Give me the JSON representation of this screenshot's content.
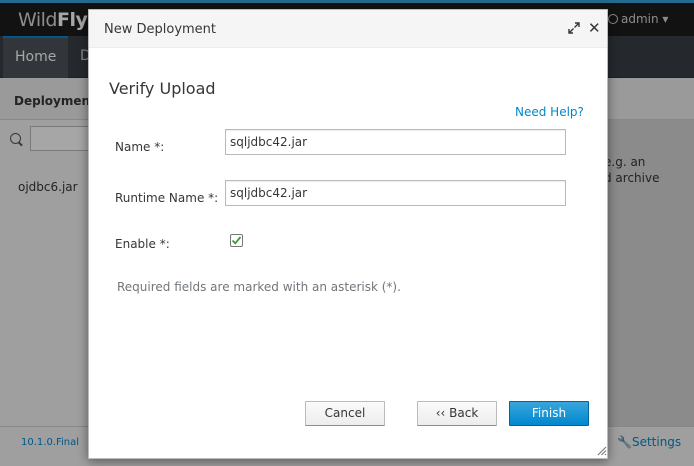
{
  "app": {
    "brand_light": "WildFly",
    "brand_bold": "",
    "user": "admin ▾",
    "nav": {
      "home": "Home",
      "d": "D"
    },
    "subheader_title": "Deployment",
    "list_item": "ojdbc6.jar",
    "right_text": "e.g. an\nd archive",
    "version": "10.1.0.Final",
    "settings": "Settings"
  },
  "modal": {
    "title": "New Deployment",
    "step_title": "Verify Upload",
    "help_link": "Need Help?",
    "fields": {
      "name_label": "Name *:",
      "name_value": "sqljdbc42.jar",
      "runtime_name_label": "Runtime Name *:",
      "runtime_name_value": "sqljdbc42.jar",
      "enable_label": "Enable *:",
      "enable_checked": true
    },
    "required_note": "Required fields are marked with an asterisk (*).",
    "buttons": {
      "cancel": "Cancel",
      "back": "‹‹ Back",
      "finish": "Finish"
    }
  },
  "colors": {
    "accent": "#0088ce",
    "checkmark": "#3f9c35",
    "topbar": "#1d1d1d",
    "navbar": "#393f45"
  },
  "icons": {
    "expand": "expand-icon",
    "close": "close-icon",
    "search": "search-icon",
    "user": "user-icon",
    "settings": "wrench-icon",
    "check": "checkmark-icon",
    "resize": "resize-grip-icon"
  }
}
